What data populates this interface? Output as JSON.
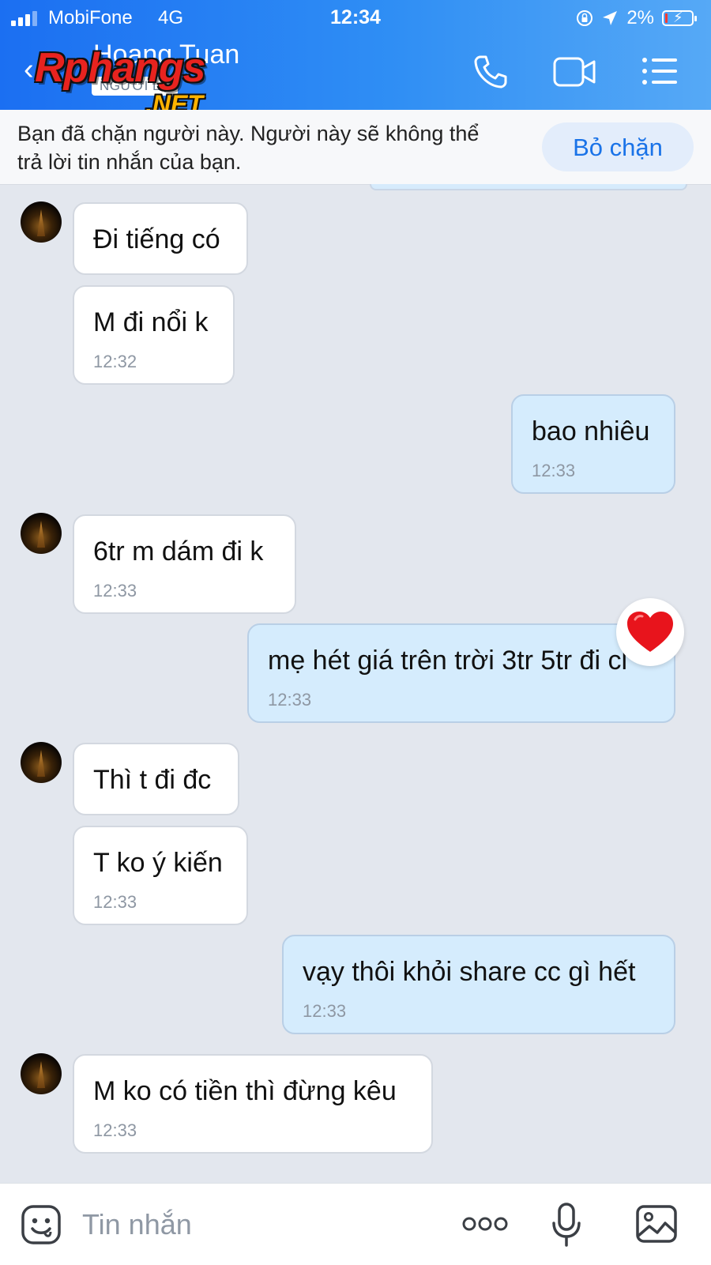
{
  "status_bar": {
    "carrier": "MobiFone",
    "network": "4G",
    "time": "12:34",
    "battery": "2%"
  },
  "header": {
    "back_icon": "‹",
    "contact_name": "Hoang Tuan",
    "stranger_badge": "NGƯỜI LẠ",
    "watermark_main": "Rphangs",
    "watermark_sub": ".NET",
    "icons": [
      "phone-icon",
      "video-call-icon",
      "menu-list-icon"
    ]
  },
  "blocked_banner": {
    "text": "Bạn đã chặn người này. Người này sẽ không thể trả lời tin nhắn của bạn.",
    "unblock_label": "Bỏ chặn"
  },
  "messages": [
    {
      "direction": "in",
      "text": "Đi tiếng có",
      "time": ""
    },
    {
      "direction": "in",
      "text": "M đi nổi k",
      "time": "12:32"
    },
    {
      "direction": "out",
      "text": "bao nhiêu",
      "time": "12:33"
    },
    {
      "direction": "in",
      "text": "6tr m dám đi k",
      "time": "12:33"
    },
    {
      "direction": "out",
      "text": "mẹ hét giá trên trời 3tr 5tr đi cl",
      "time": "12:33",
      "reaction": "heart-icon"
    },
    {
      "direction": "in",
      "text": "Thì t đi đc",
      "time": ""
    },
    {
      "direction": "in",
      "text": "T ko ý kiến",
      "time": "12:33"
    },
    {
      "direction": "out",
      "text": "vạy thôi khỏi share cc gì hết",
      "time": "12:33"
    },
    {
      "direction": "in",
      "text": "M ko có tiền thì đừng kêu",
      "time": "12:33"
    }
  ],
  "input_bar": {
    "placeholder": "Tin nhắn",
    "icons": [
      "sticker-icon",
      "more-icon",
      "microphone-icon",
      "image-icon"
    ]
  },
  "colors": {
    "header_start": "#1b6ff2",
    "header_end": "#56a9f6",
    "outgoing_bubble": "#d5ecfd",
    "incoming_bubble": "#ffffff",
    "chat_background": "#e3e7ee",
    "accent": "#1a73e8",
    "heart": "#e8141c"
  }
}
